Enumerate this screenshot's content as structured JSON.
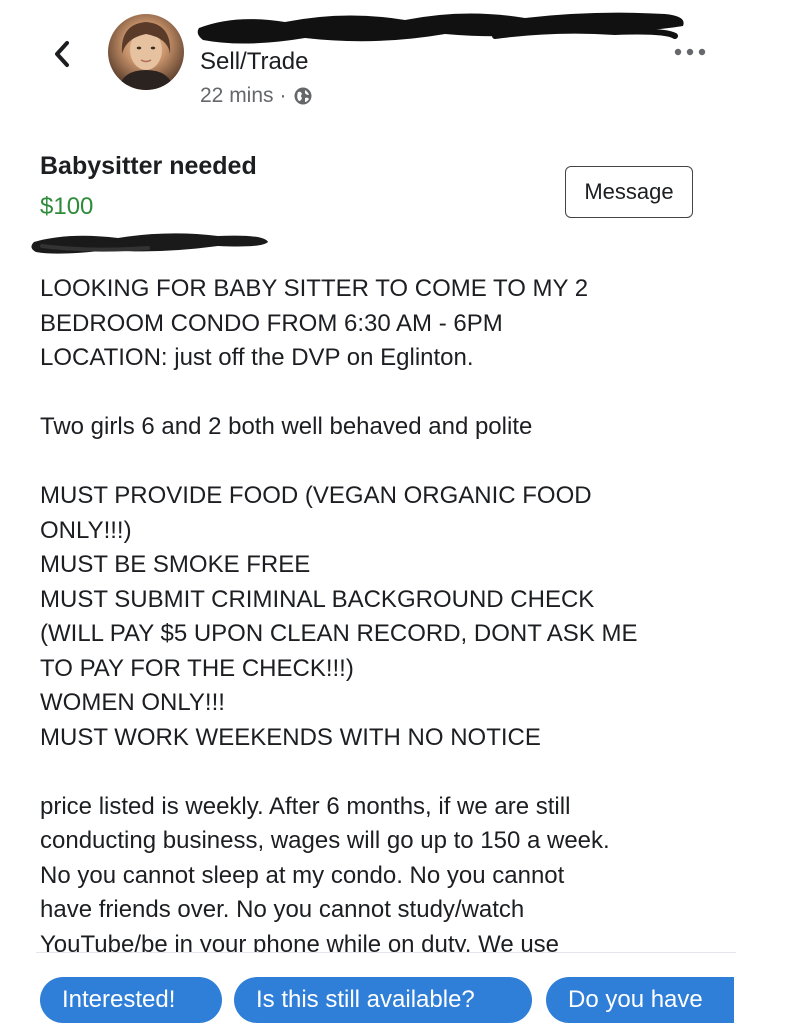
{
  "header": {
    "group_name": "Sell/Trade",
    "time_ago": "22 mins",
    "separator": "·",
    "icons": {
      "back": "chevron-left-icon",
      "privacy": "globe-icon",
      "more": "more-dots-icon"
    }
  },
  "listing": {
    "title": "Babysitter needed",
    "price": "$100",
    "message_label": "Message",
    "price_color": "#2e8b3a"
  },
  "description": {
    "lines": [
      "LOOKING FOR BABY SITTER TO COME TO MY 2",
      "BEDROOM CONDO FROM 6:30 AM - 6PM",
      "LOCATION: just off the DVP on Eglinton.",
      "",
      "Two girls 6 and 2 both well behaved and polite",
      "",
      "MUST PROVIDE FOOD (VEGAN ORGANIC FOOD",
      "ONLY!!!)",
      "MUST BE SMOKE FREE",
      "MUST SUBMIT CRIMINAL BACKGROUND CHECK",
      "(WILL PAY $5 UPON CLEAN RECORD, DONT ASK ME",
      "TO PAY FOR THE CHECK!!!)",
      "WOMEN ONLY!!!",
      "MUST WORK WEEKENDS WITH NO NOTICE",
      "",
      "price listed is weekly. After 6 months, if we are still",
      "conducting business, wages will go up to 150 a week.",
      "No you cannot sleep at my condo. No you cannot",
      "have friends over. No you cannot study/watch",
      "YouTube/be in your phone while on duty. We use"
    ]
  },
  "quick_replies": [
    "Interested!",
    "Is this still available?",
    "Do you have"
  ],
  "colors": {
    "chip_blue": "#2f7fd8",
    "meta_gray": "#65676b"
  }
}
